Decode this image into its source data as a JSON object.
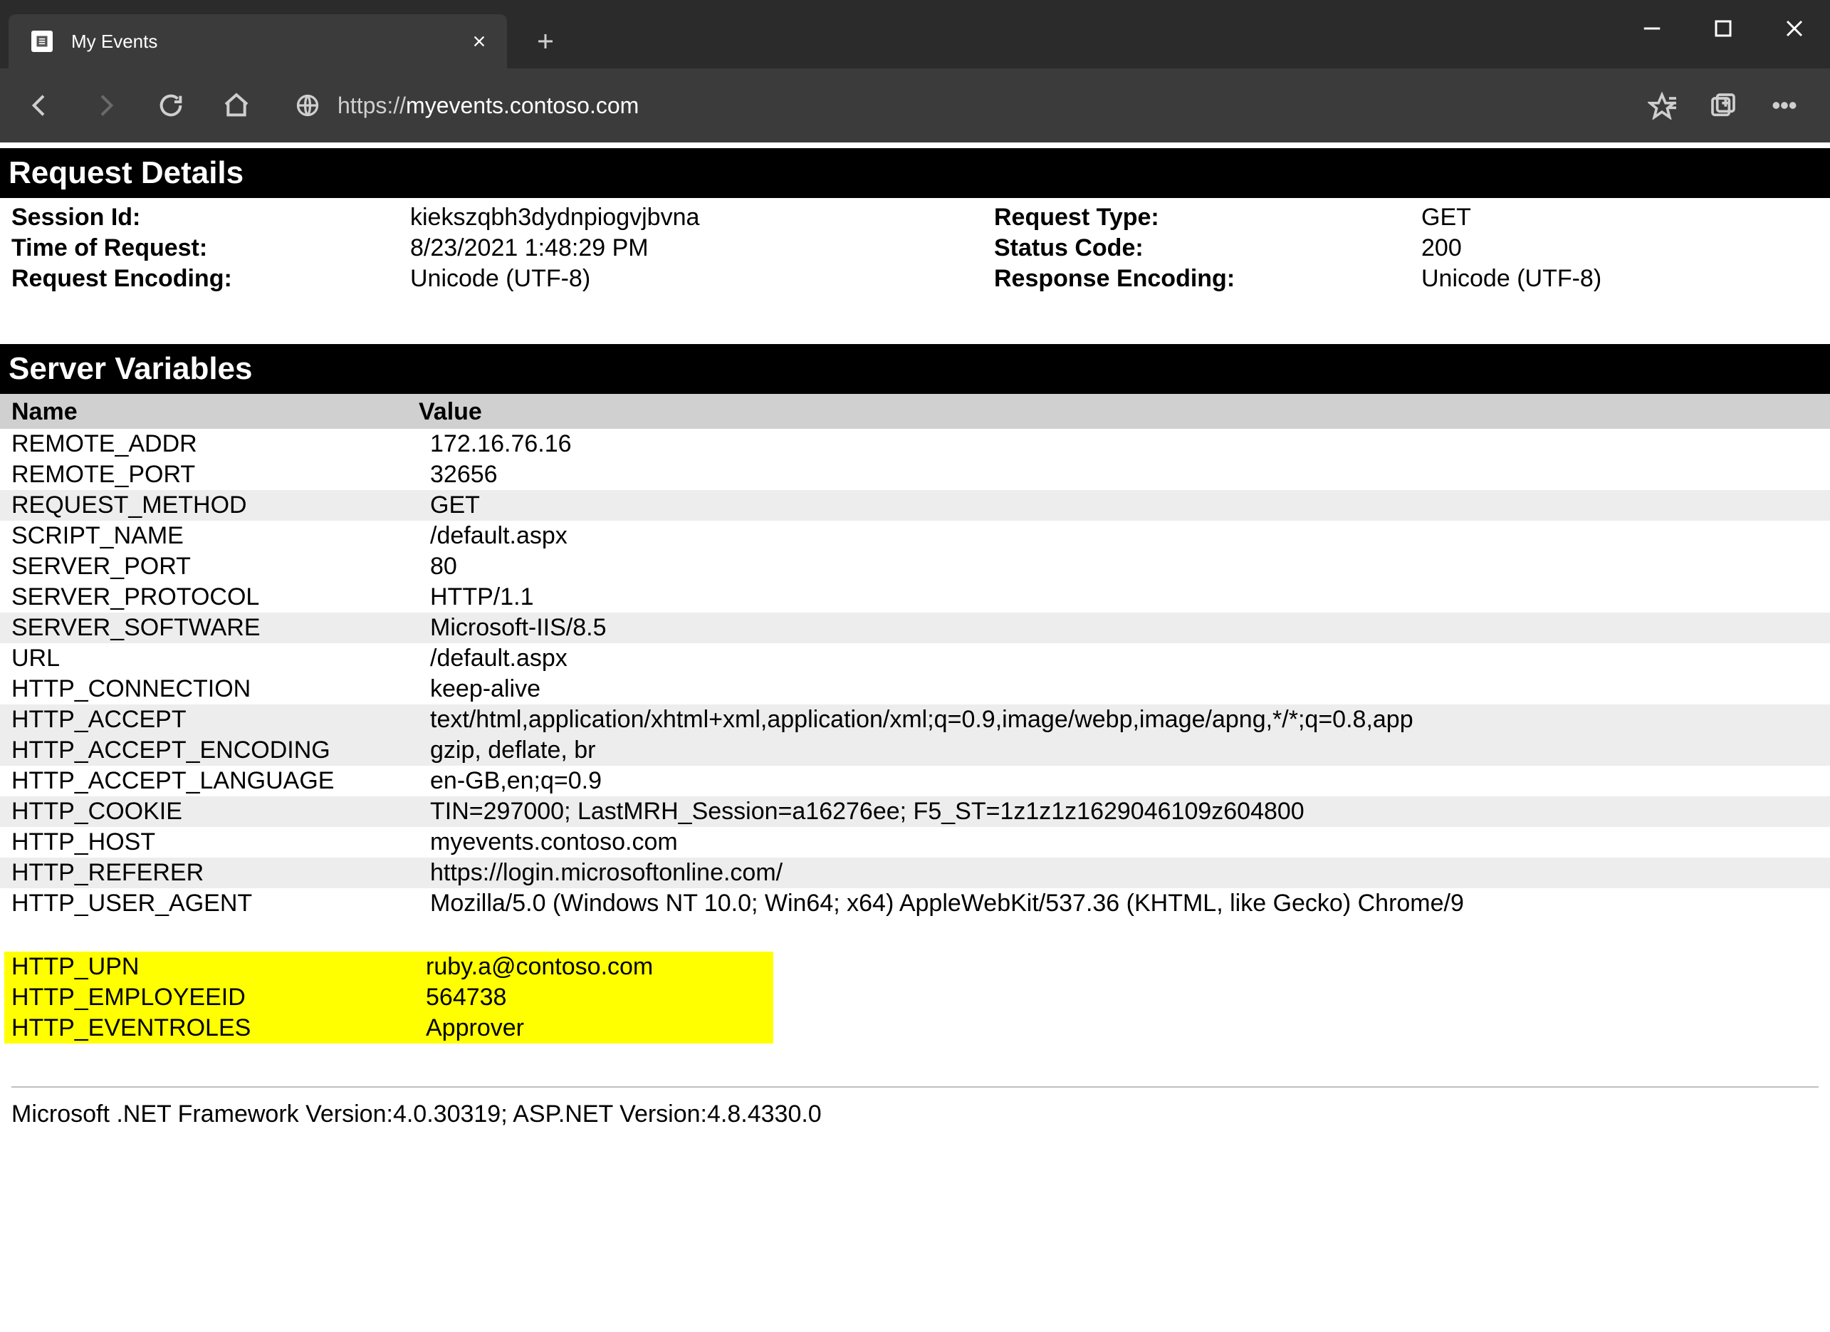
{
  "browser": {
    "tab_title": "My Events",
    "url_scheme": "https://",
    "url_host": "myevents.contoso.com",
    "url_path": ""
  },
  "sections": {
    "request_details": "Request Details",
    "server_variables": "Server Variables"
  },
  "request_details": {
    "labels": {
      "session_id": "Session Id:",
      "request_type": "Request Type:",
      "time_of_request": "Time of Request:",
      "status_code": "Status Code:",
      "request_encoding": "Request Encoding:",
      "response_encoding": "Response Encoding:"
    },
    "values": {
      "session_id": "kiekszqbh3dydnpiogvjbvna",
      "request_type": "GET",
      "time_of_request": "8/23/2021 1:48:29 PM",
      "status_code": "200",
      "request_encoding": "Unicode (UTF-8)",
      "response_encoding": "Unicode (UTF-8)"
    }
  },
  "vars_headers": {
    "name": "Name",
    "value": "Value"
  },
  "server_variables": [
    {
      "name": "REMOTE_ADDR",
      "value": "172.16.76.16"
    },
    {
      "name": "REMOTE_PORT",
      "value": "32656"
    },
    {
      "name": "REQUEST_METHOD",
      "value": "GET"
    },
    {
      "name": "SCRIPT_NAME",
      "value": "/default.aspx"
    },
    {
      "name": "SERVER_PORT",
      "value": "80"
    },
    {
      "name": "SERVER_PROTOCOL",
      "value": "HTTP/1.1"
    },
    {
      "name": "SERVER_SOFTWARE",
      "value": "Microsoft-IIS/8.5"
    },
    {
      "name": "URL",
      "value": "/default.aspx"
    },
    {
      "name": "HTTP_CONNECTION",
      "value": "keep-alive"
    },
    {
      "name": "HTTP_ACCEPT",
      "value": "text/html,application/xhtml+xml,application/xml;q=0.9,image/webp,image/apng,*/*;q=0.8,app"
    },
    {
      "name": "HTTP_ACCEPT_ENCODING",
      "value": "gzip, deflate, br"
    },
    {
      "name": "HTTP_ACCEPT_LANGUAGE",
      "value": "en-GB,en;q=0.9"
    },
    {
      "name": "HTTP_COOKIE",
      "value": "TIN=297000; LastMRH_Session=a16276ee; F5_ST=1z1z1z1629046109z604800"
    },
    {
      "name": "HTTP_HOST",
      "value": "myevents.contoso.com"
    },
    {
      "name": "HTTP_REFERER",
      "value": "https://login.microsoftonline.com/"
    },
    {
      "name": "HTTP_USER_AGENT",
      "value": "Mozilla/5.0 (Windows NT 10.0; Win64; x64) AppleWebKit/537.36 (KHTML, like Gecko) Chrome/9"
    }
  ],
  "highlight_variables": [
    {
      "name": "HTTP_UPN",
      "value": "ruby.a@contoso.com"
    },
    {
      "name": "HTTP_EMPLOYEEID",
      "value": "564738"
    },
    {
      "name": "HTTP_EVENTROLES",
      "value": "Approver"
    }
  ],
  "footer": "Microsoft .NET Framework Version:4.0.30319; ASP.NET Version:4.8.4330.0"
}
